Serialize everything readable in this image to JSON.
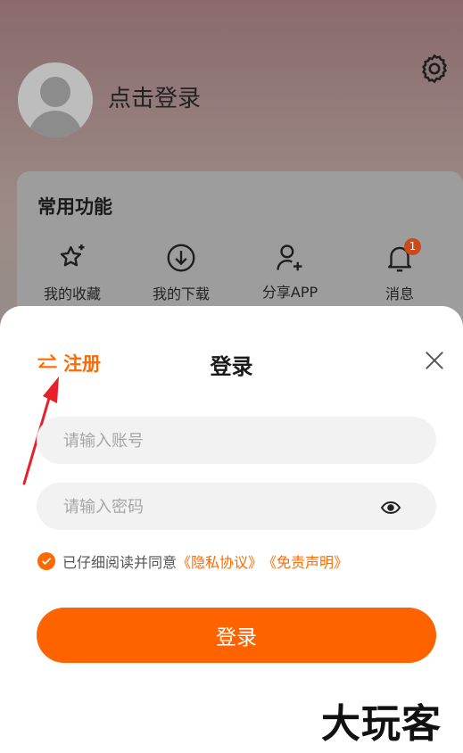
{
  "profile": {
    "login_prompt": "点击登录",
    "section_title": "常用功能",
    "functions": [
      {
        "label": "我的收藏",
        "icon": "star-plus-icon"
      },
      {
        "label": "我的下载",
        "icon": "download-icon"
      },
      {
        "label": "分享APP",
        "icon": "user-add-icon"
      },
      {
        "label": "消息",
        "icon": "bell-icon"
      }
    ],
    "message_badge": "1"
  },
  "sheet": {
    "register_label": "注册",
    "title": "登录",
    "account_placeholder": "请输入账号",
    "password_placeholder": "请输入密码",
    "agree_prefix": "已仔细阅读并同意",
    "privacy_link": "《隐私协议》",
    "disclaimer_link": "《免责声明》",
    "login_button": "登录"
  },
  "watermark": "大玩客",
  "colors": {
    "accent": "#ff6300",
    "link": "#ff6a00",
    "badge": "#c94a1a"
  }
}
